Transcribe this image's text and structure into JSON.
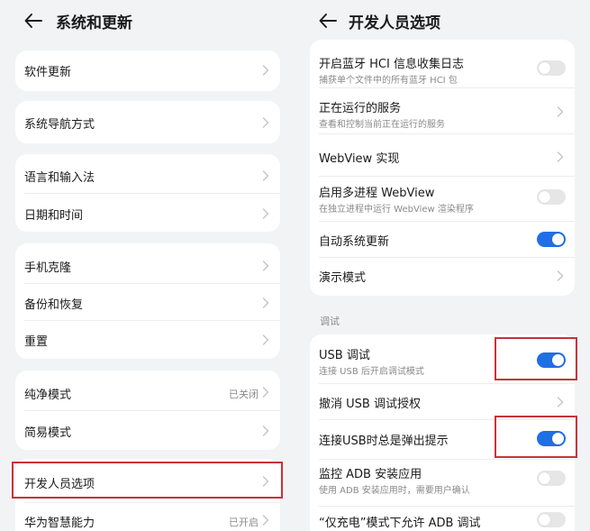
{
  "left": {
    "title": "系统和更新",
    "items": [
      {
        "label": "软件更新"
      },
      {
        "label": "系统导航方式"
      },
      {
        "label": "语言和输入法"
      },
      {
        "label": "日期和时间"
      },
      {
        "label": "手机克隆"
      },
      {
        "label": "备份和恢复"
      },
      {
        "label": "重置"
      },
      {
        "label": "纯净模式",
        "value": "已关闭"
      },
      {
        "label": "简易模式"
      },
      {
        "label": "开发人员选项"
      },
      {
        "label": "华为智慧能力",
        "value": "已开启"
      }
    ]
  },
  "right": {
    "title": "开发人员选项",
    "items": [
      {
        "label": "开启蓝牙 HCI 信息收集日志",
        "sub": "捕获单个文件中的所有蓝牙 HCI 包",
        "toggle": false
      },
      {
        "label": "正在运行的服务",
        "sub": "查看和控制当前正在运行的服务"
      },
      {
        "label": "WebView 实现"
      },
      {
        "label": "启用多进程 WebView",
        "sub": "在独立进程中运行 WebView 渲染程序",
        "toggle": false
      },
      {
        "label": "自动系统更新",
        "toggle": true
      },
      {
        "label": "演示模式"
      }
    ],
    "debug_section": "调试",
    "debug_items": [
      {
        "label": "USB 调试",
        "sub": "连接 USB 后开启调试模式",
        "toggle": true
      },
      {
        "label": "撤消 USB 调试授权"
      },
      {
        "label": "连接USB时总是弹出提示",
        "toggle": true
      },
      {
        "label": "监控 ADB 安装应用",
        "sub": "使用 ADB 安装应用时，需要用户确认",
        "toggle": false
      },
      {
        "label": "“仅充电”模式下允许 ADB 调试",
        "toggle": false
      }
    ]
  },
  "colors": {
    "toggle_on": "#1f6fe5",
    "highlight": "#c8323b",
    "background": "#f1f3f5"
  }
}
